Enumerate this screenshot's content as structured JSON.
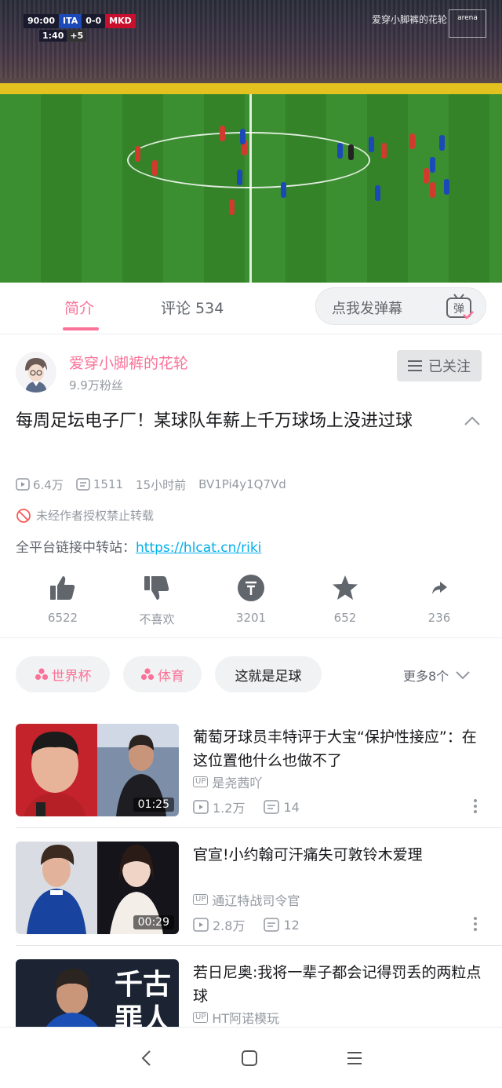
{
  "video": {
    "scoreboard": {
      "clock": "90:00",
      "home": "ITA",
      "score": "0-0",
      "away": "MKD",
      "extra_clock": "1:40",
      "added_time": "+5"
    },
    "watermark": "爱穿小脚裤的花轮",
    "broadcaster_logo": "arena"
  },
  "tabs": {
    "intro": "简介",
    "comments": "评论 534"
  },
  "danmaku": {
    "placeholder": "点我发弹幕",
    "icon_char": "弹"
  },
  "author": {
    "name": "爱穿小脚裤的花轮",
    "fans": "9.9万粉丝",
    "follow_label": "已关注"
  },
  "video_info": {
    "title": "每周足坛电子厂！某球队年薪上千万球场上没进过球",
    "views": "6.4万",
    "danmaku_count": "1511",
    "time_ago": "15小时前",
    "bvid": "BV1Pi4y1Q7Vd",
    "no_repost": "未经作者授权禁止转载",
    "link_prefix": "全平台链接中转站：",
    "link_url": "https://hlcat.cn/riki"
  },
  "actions": {
    "like": "6522",
    "dislike": "不喜欢",
    "coin": "3201",
    "favorite": "652",
    "share": "236"
  },
  "tags": {
    "items": [
      "世界杯",
      "体育",
      "这就是足球"
    ],
    "more": "更多8个"
  },
  "related": [
    {
      "title": "葡萄牙球员丰特评于大宝“保护性接应”：在这位置他什么也做不了",
      "up": "是尧茜吖",
      "views": "1.2万",
      "danmaku": "14",
      "duration": "01:25"
    },
    {
      "title": "官宣!小约翰可汗痛失可敦铃木爱理",
      "up": "通辽特战司令官",
      "views": "2.8万",
      "danmaku": "12",
      "duration": "00:29"
    },
    {
      "title": "若日尼奥:我将一辈子都会记得罚丢的两粒点球",
      "up": "HT阿诺模玩",
      "thumb_text_1": "千古",
      "thumb_text_2": "罪人"
    }
  ],
  "up_badge": "UP",
  "colors": {
    "accent": "#fb7299",
    "link": "#00aeec",
    "muted": "#9499a0"
  }
}
